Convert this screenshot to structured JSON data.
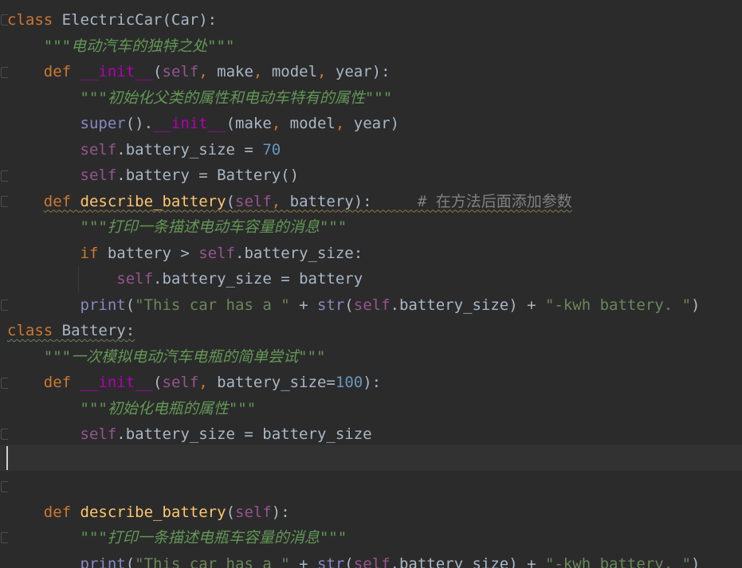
{
  "lines": [
    {
      "tokens": [
        {
          "t": "class",
          "c": "kw"
        },
        {
          "t": " ElectricCar",
          "c": "tx"
        },
        {
          "t": "(Car):",
          "c": "tx"
        }
      ]
    },
    {
      "tokens": [
        {
          "t": "    \"\"\"电动汽车的独特之处\"\"\"",
          "c": "dc"
        }
      ]
    },
    {
      "tokens": [
        {
          "t": "    ",
          "c": "tx"
        },
        {
          "t": "def ",
          "c": "kw"
        },
        {
          "t": "__init__",
          "c": "mg"
        },
        {
          "t": "(",
          "c": "tx"
        },
        {
          "t": "self",
          "c": "sf"
        },
        {
          "t": ", ",
          "c": "kw"
        },
        {
          "t": "make",
          "c": "tx"
        },
        {
          "t": ", ",
          "c": "kw"
        },
        {
          "t": "model",
          "c": "tx"
        },
        {
          "t": ", ",
          "c": "kw"
        },
        {
          "t": "year):",
          "c": "tx"
        }
      ]
    },
    {
      "tokens": [
        {
          "t": "        \"\"\"初始化父类的属性和电动车特有的属性\"\"\"",
          "c": "dc"
        }
      ]
    },
    {
      "tokens": [
        {
          "t": "        ",
          "c": "tx"
        },
        {
          "t": "super",
          "c": "bi"
        },
        {
          "t": "().",
          "c": "tx"
        },
        {
          "t": "__init__",
          "c": "mg"
        },
        {
          "t": "(make",
          "c": "tx"
        },
        {
          "t": ", ",
          "c": "kw"
        },
        {
          "t": "model",
          "c": "tx"
        },
        {
          "t": ", ",
          "c": "kw"
        },
        {
          "t": "year)",
          "c": "tx"
        }
      ]
    },
    {
      "tokens": [
        {
          "t": "        ",
          "c": "tx"
        },
        {
          "t": "self",
          "c": "sf"
        },
        {
          "t": ".battery_size = ",
          "c": "tx"
        },
        {
          "t": "70",
          "c": "nm"
        }
      ]
    },
    {
      "tokens": [
        {
          "t": "        ",
          "c": "tx"
        },
        {
          "t": "self",
          "c": "sf"
        },
        {
          "t": ".battery = Battery()",
          "c": "tx"
        }
      ]
    },
    {
      "tokens": [
        {
          "t": "    ",
          "c": "tx"
        },
        {
          "t": "def ",
          "c": "kw wavy"
        },
        {
          "t": "describe_battery",
          "c": "fn wavy"
        },
        {
          "t": "(",
          "c": "tx wavy"
        },
        {
          "t": "self",
          "c": "sf wavy"
        },
        {
          "t": ", ",
          "c": "kw wavy"
        },
        {
          "t": "battery):     ",
          "c": "tx wavy"
        },
        {
          "t": "# 在方法后面添加参数",
          "c": "cm wavy"
        }
      ]
    },
    {
      "tokens": [
        {
          "t": "        \"\"\"打印一条描述电动车容量的消息\"\"\"",
          "c": "dc"
        }
      ]
    },
    {
      "tokens": [
        {
          "t": "        ",
          "c": "tx"
        },
        {
          "t": "if ",
          "c": "kw"
        },
        {
          "t": "battery > ",
          "c": "tx"
        },
        {
          "t": "self",
          "c": "sf"
        },
        {
          "t": ".battery_size:",
          "c": "tx"
        }
      ]
    },
    {
      "tokens": [
        {
          "t": "            ",
          "c": "tx"
        },
        {
          "t": "self",
          "c": "sf"
        },
        {
          "t": ".battery_size = battery",
          "c": "tx"
        }
      ]
    },
    {
      "tokens": [
        {
          "t": "        ",
          "c": "tx"
        },
        {
          "t": "print",
          "c": "bi"
        },
        {
          "t": "(",
          "c": "tx"
        },
        {
          "t": "\"This car has a \"",
          "c": "st"
        },
        {
          "t": " + ",
          "c": "tx"
        },
        {
          "t": "str",
          "c": "bi"
        },
        {
          "t": "(",
          "c": "tx"
        },
        {
          "t": "self",
          "c": "sf"
        },
        {
          "t": ".battery_size) + ",
          "c": "tx"
        },
        {
          "t": "\"-kwh battery. \"",
          "c": "st"
        },
        {
          "t": ")",
          "c": "tx"
        }
      ]
    },
    {
      "tokens": [
        {
          "t": "class",
          "c": "kw wavy-g"
        },
        {
          "t": " Battery:",
          "c": "tx wavy-g"
        }
      ]
    },
    {
      "tokens": [
        {
          "t": "    \"\"\"一次模拟电动汽车电瓶的简单尝试\"\"\"",
          "c": "dc"
        }
      ]
    },
    {
      "tokens": [
        {
          "t": "    ",
          "c": "tx"
        },
        {
          "t": "def ",
          "c": "kw"
        },
        {
          "t": "__init__",
          "c": "mg"
        },
        {
          "t": "(",
          "c": "tx"
        },
        {
          "t": "self",
          "c": "sf"
        },
        {
          "t": ", ",
          "c": "kw"
        },
        {
          "t": "battery_size=",
          "c": "tx"
        },
        {
          "t": "100",
          "c": "nm"
        },
        {
          "t": "):",
          "c": "tx"
        }
      ]
    },
    {
      "tokens": [
        {
          "t": "        \"\"\"初始化电瓶的属性\"\"\"",
          "c": "dc"
        }
      ]
    },
    {
      "tokens": [
        {
          "t": "        ",
          "c": "tx"
        },
        {
          "t": "self",
          "c": "sf"
        },
        {
          "t": ".battery_size = battery_size",
          "c": "tx"
        }
      ]
    },
    {
      "tokens": []
    },
    {
      "tokens": []
    },
    {
      "tokens": [
        {
          "t": "    ",
          "c": "tx"
        },
        {
          "t": "def ",
          "c": "kw"
        },
        {
          "t": "describe_battery",
          "c": "fn"
        },
        {
          "t": "(",
          "c": "tx"
        },
        {
          "t": "self",
          "c": "sf"
        },
        {
          "t": "):",
          "c": "tx"
        }
      ]
    },
    {
      "tokens": [
        {
          "t": "        \"\"\"打印一条描述电瓶车容量的消息\"\"\"",
          "c": "dc"
        }
      ]
    },
    {
      "tokens": [
        {
          "t": "        ",
          "c": "tx"
        },
        {
          "t": "print",
          "c": "bi"
        },
        {
          "t": "(",
          "c": "tx"
        },
        {
          "t": "\"This car has a \"",
          "c": "st"
        },
        {
          "t": " + ",
          "c": "tx"
        },
        {
          "t": "str",
          "c": "bi"
        },
        {
          "t": "(",
          "c": "tx"
        },
        {
          "t": "self",
          "c": "sf"
        },
        {
          "t": ".battery_size) + ",
          "c": "tx"
        },
        {
          "t": "\"-kwh battery. \"",
          "c": "st"
        },
        {
          "t": ")",
          "c": "tx"
        }
      ]
    }
  ],
  "colors": {
    "background": "#2b2b2b",
    "current_line": "#323232",
    "keyword": "#cc7832",
    "function": "#ffc66d",
    "magic": "#b200b2",
    "self": "#94558d",
    "builtin": "#8888c6",
    "number": "#6897bb",
    "string": "#6a8759",
    "docstring": "#629755",
    "comment": "#808080",
    "text": "#a9b7c6"
  }
}
